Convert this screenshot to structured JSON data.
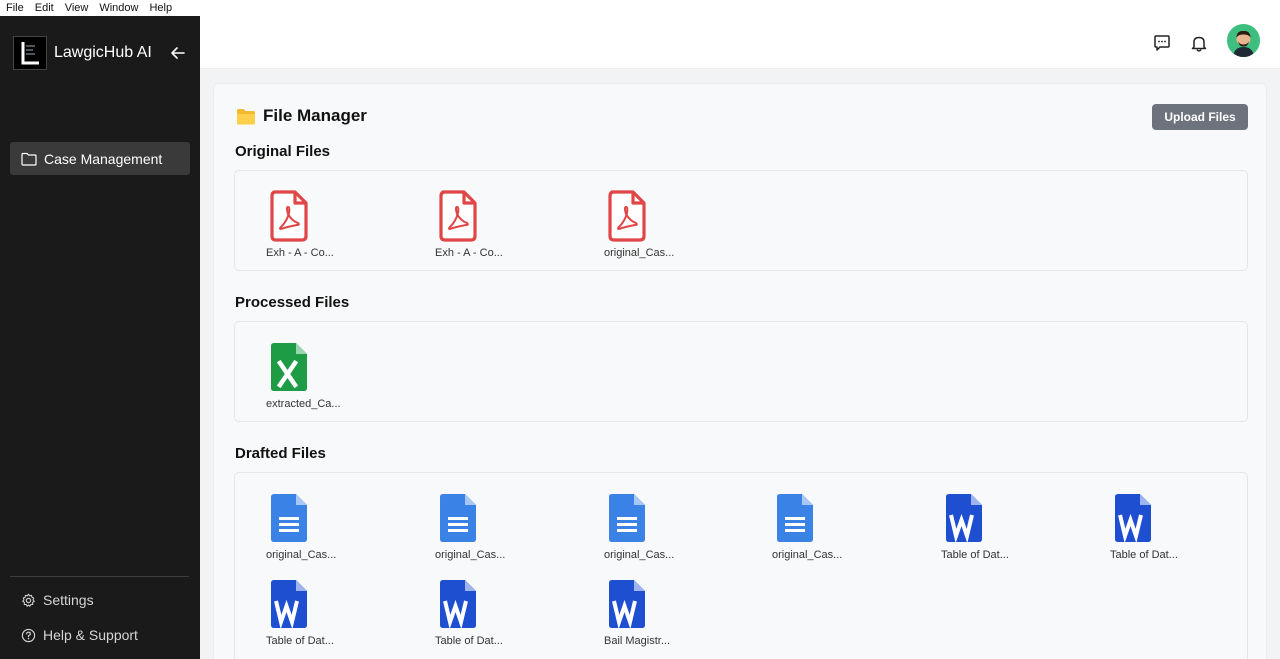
{
  "menubar": [
    "File",
    "Edit",
    "View",
    "Window",
    "Help"
  ],
  "brand": {
    "name": "LawgicHub AI"
  },
  "sidebar": {
    "nav_item": "Case Management",
    "settings": "Settings",
    "help": "Help & Support"
  },
  "page": {
    "title": "File Manager",
    "upload_label": "Upload Files"
  },
  "sections": {
    "original": {
      "title": "Original Files",
      "files": [
        {
          "name": "Exh - A - Co...",
          "type": "pdf"
        },
        {
          "name": "Exh - A - Co...",
          "type": "pdf"
        },
        {
          "name": "original_Cas...",
          "type": "pdf"
        }
      ]
    },
    "processed": {
      "title": "Processed Files",
      "files": [
        {
          "name": "extracted_Ca...",
          "type": "excel"
        }
      ]
    },
    "drafted": {
      "title": "Drafted Files",
      "files": [
        {
          "name": "original_Cas...",
          "type": "gdoc"
        },
        {
          "name": "original_Cas...",
          "type": "gdoc"
        },
        {
          "name": "original_Cas...",
          "type": "gdoc"
        },
        {
          "name": "original_Cas...",
          "type": "gdoc"
        },
        {
          "name": "Table of Dat...",
          "type": "word"
        },
        {
          "name": "Table of Dat...",
          "type": "word"
        },
        {
          "name": "Table of Dat...",
          "type": "word"
        },
        {
          "name": "Table of Dat...",
          "type": "word"
        },
        {
          "name": "Bail Magistr...",
          "type": "word"
        }
      ]
    }
  },
  "colors": {
    "sidebar_bg": "#1a1a1a",
    "nav_active": "#3a3a3a",
    "pdf": "#e04646",
    "excel": "#1e9b45",
    "gdoc": "#3b82e6",
    "word": "#1e4fd1",
    "upload_btn": "#6c737c",
    "folder": "#f5b82e"
  }
}
